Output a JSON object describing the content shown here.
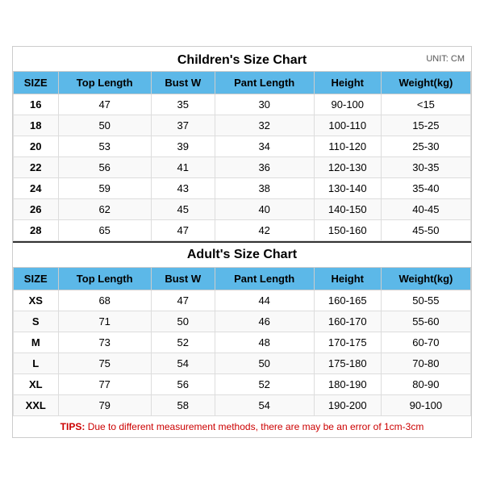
{
  "children_title": "Children's Size Chart",
  "adult_title": "Adult's Size Chart",
  "unit": "UNIT: CM",
  "headers": [
    "SIZE",
    "Top Length",
    "Bust W",
    "Pant Length",
    "Height",
    "Weight(kg)"
  ],
  "children_rows": [
    [
      "16",
      "47",
      "35",
      "30",
      "90-100",
      "<15"
    ],
    [
      "18",
      "50",
      "37",
      "32",
      "100-110",
      "15-25"
    ],
    [
      "20",
      "53",
      "39",
      "34",
      "110-120",
      "25-30"
    ],
    [
      "22",
      "56",
      "41",
      "36",
      "120-130",
      "30-35"
    ],
    [
      "24",
      "59",
      "43",
      "38",
      "130-140",
      "35-40"
    ],
    [
      "26",
      "62",
      "45",
      "40",
      "140-150",
      "40-45"
    ],
    [
      "28",
      "65",
      "47",
      "42",
      "150-160",
      "45-50"
    ]
  ],
  "adult_rows": [
    [
      "XS",
      "68",
      "47",
      "44",
      "160-165",
      "50-55"
    ],
    [
      "S",
      "71",
      "50",
      "46",
      "160-170",
      "55-60"
    ],
    [
      "M",
      "73",
      "52",
      "48",
      "170-175",
      "60-70"
    ],
    [
      "L",
      "75",
      "54",
      "50",
      "175-180",
      "70-80"
    ],
    [
      "XL",
      "77",
      "56",
      "52",
      "180-190",
      "80-90"
    ],
    [
      "XXL",
      "79",
      "58",
      "54",
      "190-200",
      "90-100"
    ]
  ],
  "tips_label": "TIPS:",
  "tips_text": "Due to different measurement methods, there are may be an error of 1cm-3cm"
}
